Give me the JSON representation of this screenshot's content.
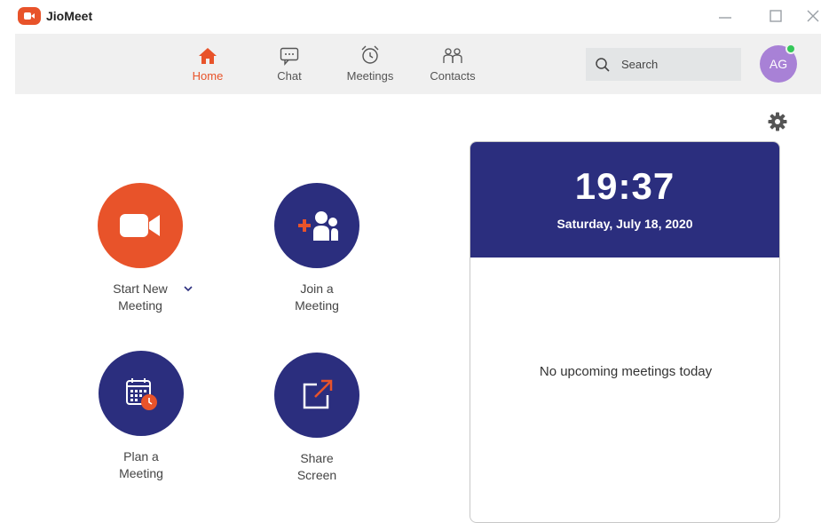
{
  "window": {
    "title": "JioMeet",
    "controls": {
      "minimize": "—",
      "maximize": "❐",
      "close": "✕"
    }
  },
  "colors": {
    "accent": "#e8532a",
    "navy": "#2b2e7e",
    "avatar": "#a881d6",
    "presence": "#34c759"
  },
  "nav": {
    "items": [
      {
        "label": "Home",
        "icon": "home-icon",
        "active": true
      },
      {
        "label": "Chat",
        "icon": "chat-icon",
        "active": false
      },
      {
        "label": "Meetings",
        "icon": "alarm-clock-icon",
        "active": false
      },
      {
        "label": "Contacts",
        "icon": "contacts-icon",
        "active": false
      }
    ],
    "search": {
      "placeholder": "Search",
      "value": ""
    },
    "avatar": {
      "initials": "AG",
      "status": "online"
    }
  },
  "actions": {
    "start": {
      "label": "Start New\nMeeting",
      "icon": "video-camera-icon"
    },
    "join": {
      "label": "Join a\nMeeting",
      "icon": "add-people-icon"
    },
    "plan": {
      "label": "Plan a\nMeeting",
      "icon": "calendar-icon"
    },
    "share": {
      "label": "Share\nScreen",
      "icon": "share-screen-icon"
    }
  },
  "panel": {
    "time": "19:37",
    "date": "Saturday, July 18, 2020",
    "empty_message": "No upcoming meetings today"
  }
}
